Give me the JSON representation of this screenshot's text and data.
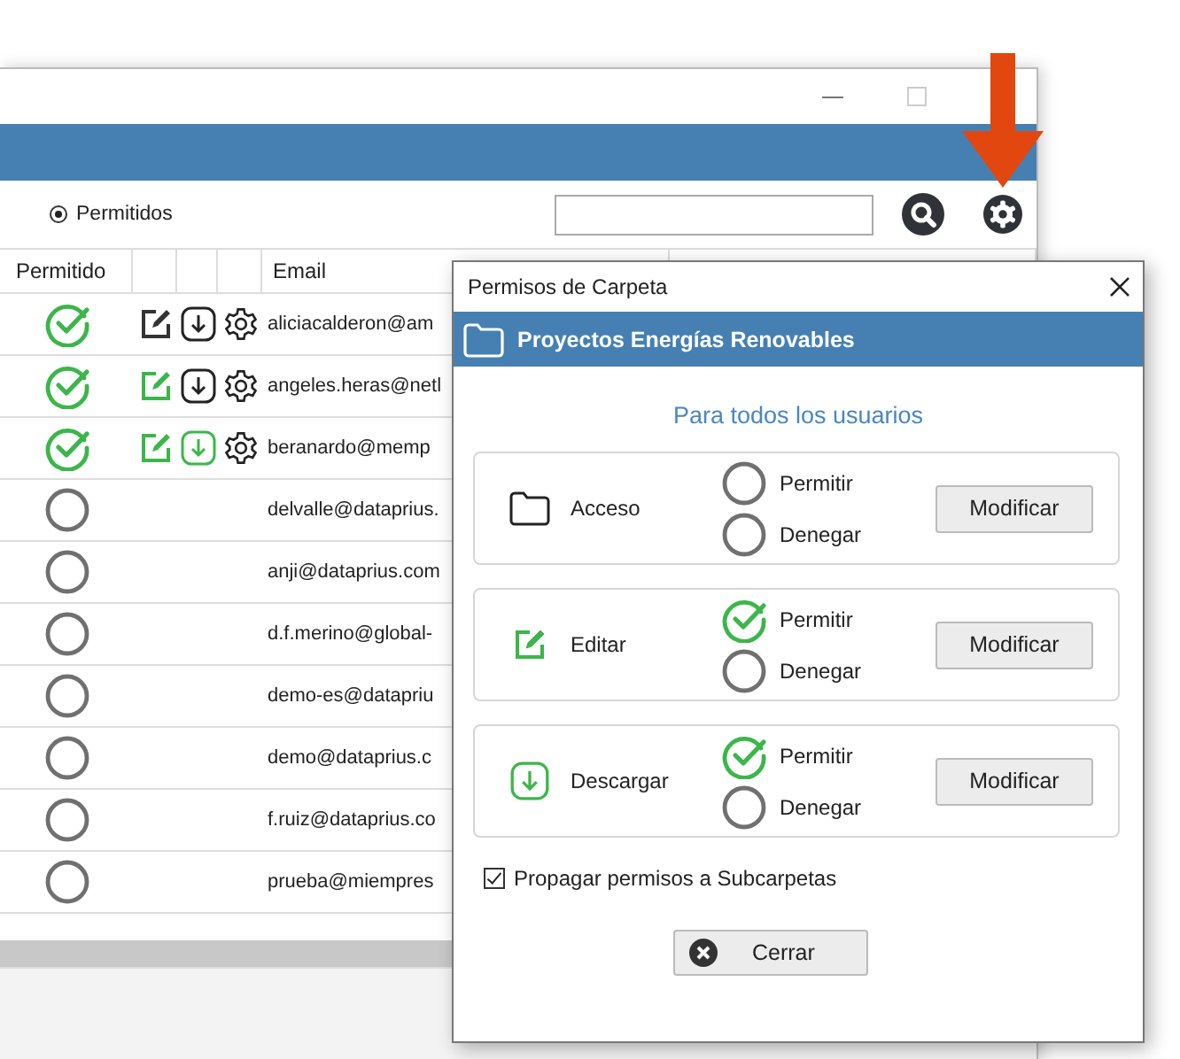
{
  "main_window": {
    "filter": {
      "label": "Permitidos",
      "selected": true
    },
    "table": {
      "columns": [
        "Permitido",
        "Email"
      ],
      "rows": [
        {
          "permitted": true,
          "edit": false,
          "download": false,
          "email": "aliciacalderon@am"
        },
        {
          "permitted": true,
          "edit": true,
          "download": false,
          "email": "angeles.heras@netl"
        },
        {
          "permitted": true,
          "edit": true,
          "download": true,
          "email": "beranardo@memp"
        },
        {
          "permitted": false,
          "email": "delvalle@dataprius."
        },
        {
          "permitted": false,
          "email": "anji@dataprius.com"
        },
        {
          "permitted": false,
          "email": "d.f.merino@global-"
        },
        {
          "permitted": false,
          "email": "demo-es@datapriu"
        },
        {
          "permitted": false,
          "email": "demo@dataprius.c"
        },
        {
          "permitted": false,
          "email": "f.ruiz@dataprius.co"
        },
        {
          "permitted": false,
          "email": "prueba@miempres"
        }
      ]
    }
  },
  "dialog": {
    "title": "Permisos de Carpeta",
    "folder": "Proyectos Energías Renovables",
    "subtitle": "Para todos los usuarios",
    "sections": [
      {
        "kind": "folder",
        "label": "Acceso",
        "allow": {
          "label": "Permitir",
          "selected": false
        },
        "deny": {
          "label": "Denegar",
          "selected": false
        },
        "button": "Modificar"
      },
      {
        "kind": "edit",
        "label": "Editar",
        "allow": {
          "label": "Permitir",
          "selected": true
        },
        "deny": {
          "label": "Denegar",
          "selected": false
        },
        "button": "Modificar"
      },
      {
        "kind": "download",
        "label": "Descargar",
        "allow": {
          "label": "Permitir",
          "selected": true
        },
        "deny": {
          "label": "Denegar",
          "selected": false
        },
        "button": "Modificar"
      }
    ],
    "propagate": {
      "label": "Propagar permisos a Subcarpetas",
      "checked": true
    },
    "close_button": "Cerrar"
  }
}
